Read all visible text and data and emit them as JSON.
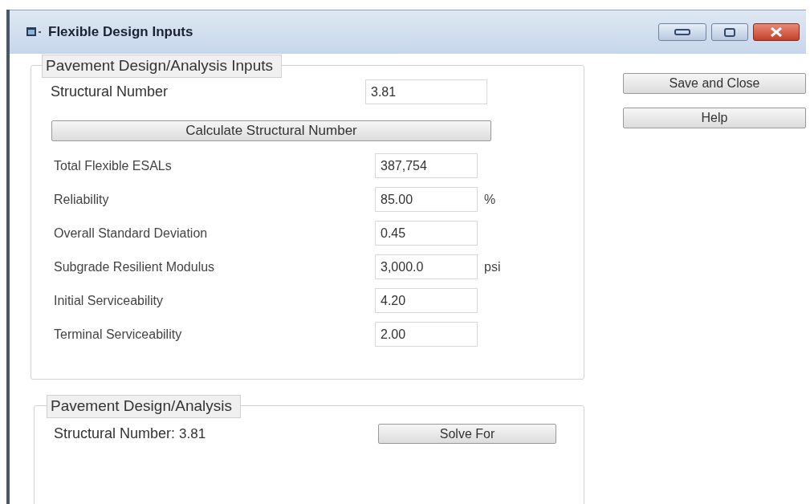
{
  "window": {
    "title": "Flexible Design Inputs"
  },
  "inputs_group": {
    "legend": "Pavement Design/Analysis Inputs",
    "structural_number": {
      "label": "Structural Number",
      "value": "3.81"
    },
    "calculate_button": "Calculate Structural Number",
    "fields": [
      {
        "label": "Total Flexible ESALs",
        "value": "387,754"
      },
      {
        "label": "Reliability",
        "value": "85.00",
        "unit": "%"
      },
      {
        "label": "Overall Standard Deviation",
        "value": "0.45"
      },
      {
        "label": "Subgrade Resilient Modulus",
        "value": "3,000.0",
        "unit": "psi"
      },
      {
        "label": "Initial Serviceability",
        "value": "4.20"
      },
      {
        "label": "Terminal Serviceability",
        "value": "2.00"
      }
    ]
  },
  "side_buttons": [
    "Save and Close",
    "Help"
  ],
  "analysis_group": {
    "legend": "Pavement Design/Analysis",
    "result_label": "Structural Number:",
    "result_value": "3.81",
    "solve_button": "Solve For"
  }
}
